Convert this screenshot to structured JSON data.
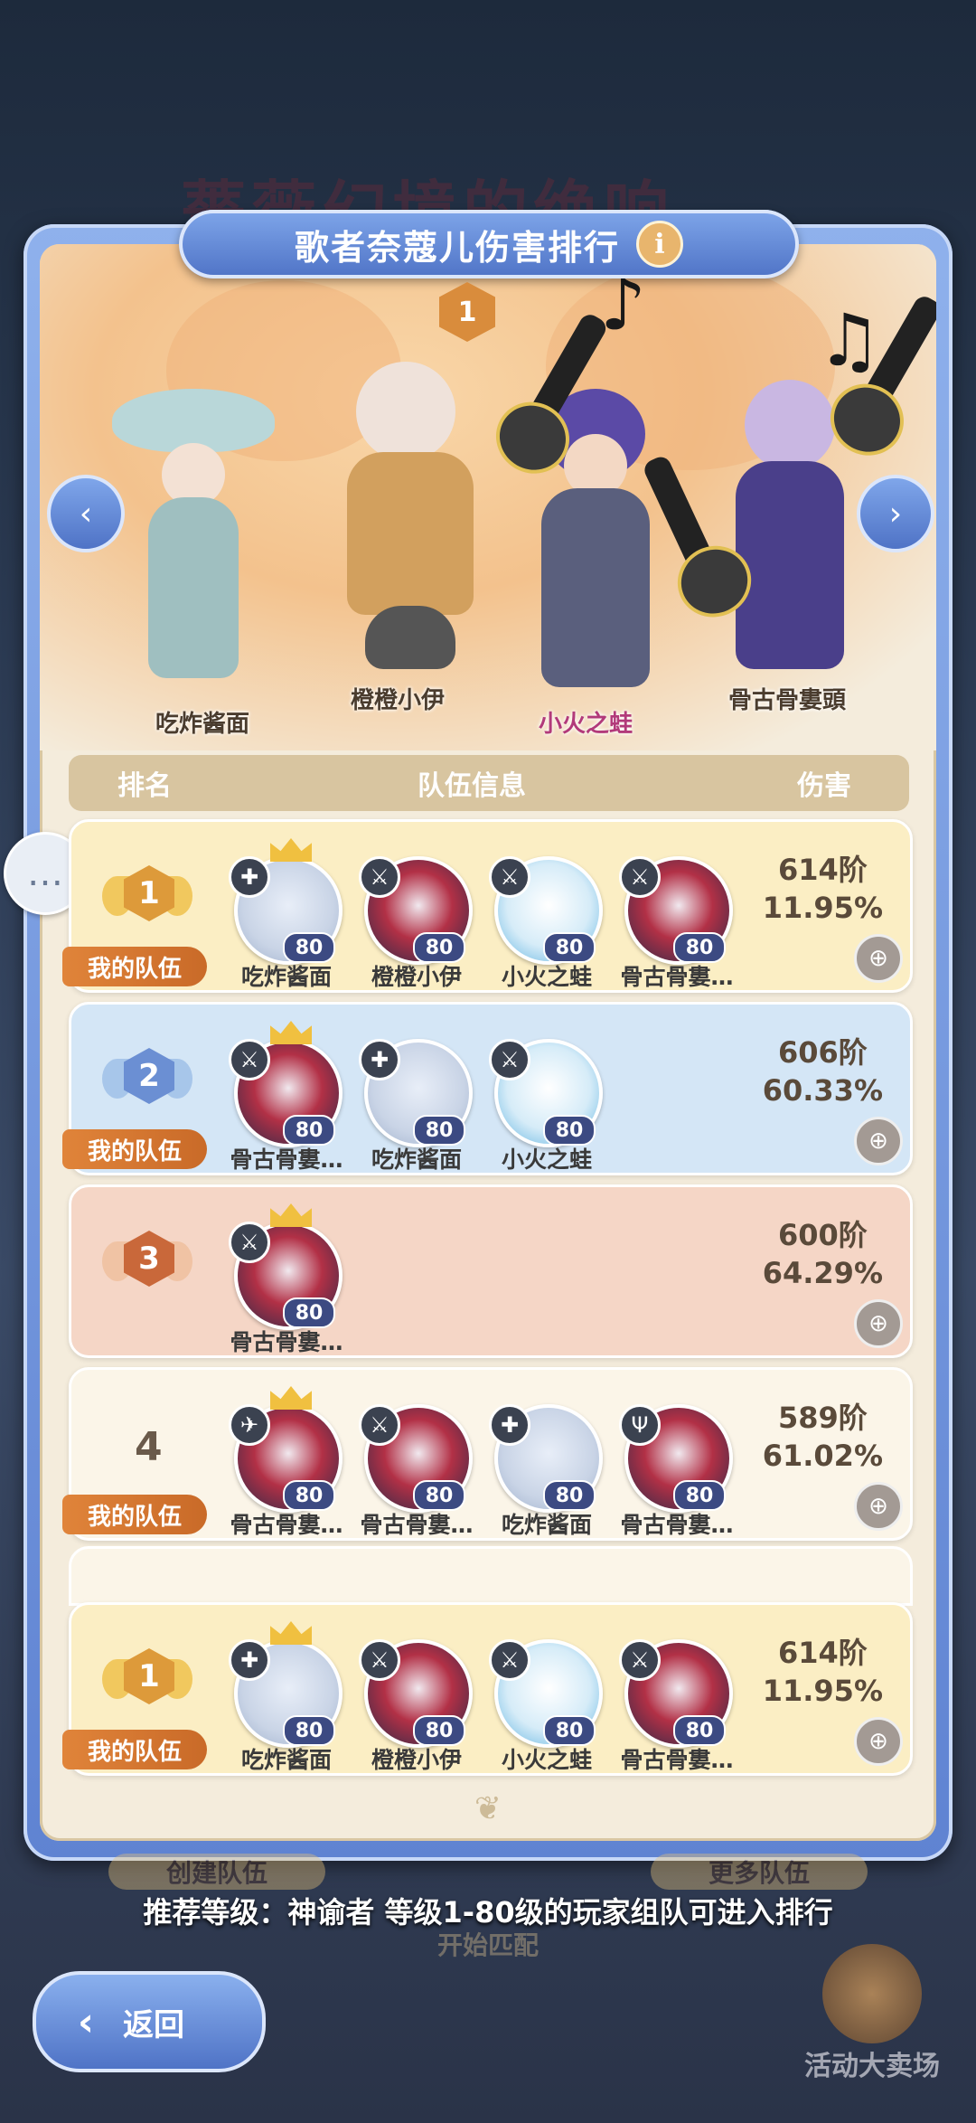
{
  "background": {
    "title_text": "薔薇幻境的绝响"
  },
  "panel": {
    "title": "歌者奈蔻儿伤害排行",
    "info_icon": "info-icon",
    "top_rank_badge": "1"
  },
  "showcase": {
    "characters": [
      {
        "name": "吃炸酱面"
      },
      {
        "name": "橙橙小伊"
      },
      {
        "name": "小火之蛙"
      },
      {
        "name": "骨古骨婁頭"
      }
    ]
  },
  "table": {
    "headers": {
      "rank": "排名",
      "team": "队伍信息",
      "damage": "伤害"
    },
    "my_team_label": "我的队伍",
    "level": "80",
    "rows": [
      {
        "rank": "1",
        "damage_tier": "614阶",
        "damage_pct": "11.95%",
        "members": [
          "吃炸酱面",
          "橙橙小伊",
          "小火之蛙",
          "骨古骨婁…"
        ]
      },
      {
        "rank": "2",
        "damage_tier": "606阶",
        "damage_pct": "60.33%",
        "members": [
          "骨古骨婁…",
          "吃炸酱面",
          "小火之蛙"
        ]
      },
      {
        "rank": "3",
        "damage_tier": "600阶",
        "damage_pct": "64.29%",
        "members": [
          "骨古骨婁…"
        ]
      },
      {
        "rank": "4",
        "damage_tier": "589阶",
        "damage_pct": "61.02%",
        "members": [
          "骨古骨婁…",
          "骨古骨婁…",
          "吃炸酱面",
          "骨古骨婁…"
        ]
      }
    ],
    "my_row": {
      "rank": "1",
      "damage_tier": "614阶",
      "damage_pct": "11.95%",
      "members": [
        "吃炸酱面",
        "橙橙小伊",
        "小火之蛙",
        "骨古骨婁…"
      ]
    }
  },
  "footer": {
    "recommend_text": "推荐等级：神谕者  等级1-80级的玩家组队可进入排行",
    "back_label": "返回",
    "event_label": "活动大卖场",
    "hidden_create": "创建队伍",
    "hidden_more": "更多队伍",
    "hidden_match": "开始匹配"
  },
  "colors": {
    "gold_row": "#fbeec4",
    "blue_row": "#d4e6f6",
    "bronze_row": "#f5d6c6",
    "plain_row": "#fbf5e8",
    "accent_blue": "#5f83d2",
    "tag_orange": "#d9782f"
  }
}
